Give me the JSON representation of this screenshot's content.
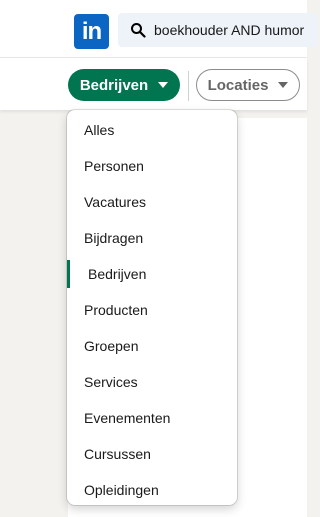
{
  "header": {
    "logo_text": "in",
    "search_icon": "search-icon",
    "search_value": "boekhouder AND humor"
  },
  "filters": {
    "active_label": "Bedrijven",
    "secondary_label": "Locaties",
    "active_color": "#01754f"
  },
  "menu": {
    "items": [
      {
        "label": "Alles"
      },
      {
        "label": "Personen"
      },
      {
        "label": "Vacatures"
      },
      {
        "label": "Bijdragen"
      },
      {
        "label": "Bedrijven",
        "selected": true
      },
      {
        "label": "Producten"
      },
      {
        "label": "Groepen"
      },
      {
        "label": "Services"
      },
      {
        "label": "Evenementen"
      },
      {
        "label": "Cursussen"
      },
      {
        "label": "Opleidingen"
      }
    ]
  }
}
